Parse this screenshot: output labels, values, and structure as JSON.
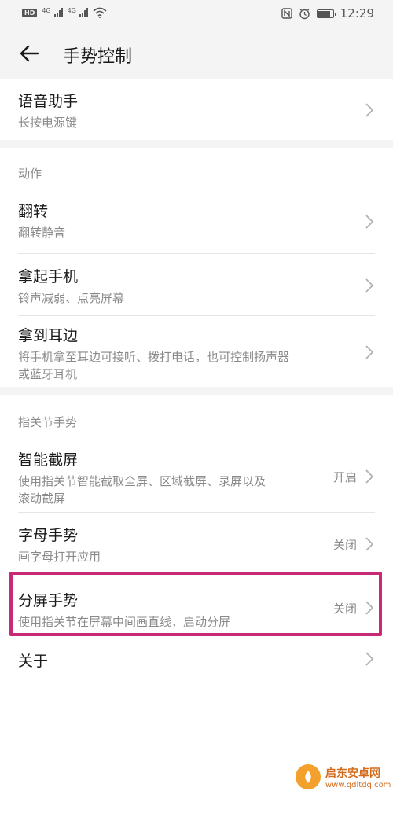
{
  "status_bar": {
    "left_badge": "HD",
    "net1": "4G",
    "net2": "4G",
    "time": "12:29",
    "nfc": "N",
    "icons": [
      "hd-badge-icon",
      "signal-icon",
      "wifi-icon",
      "nfc-icon",
      "alarm-icon",
      "battery-icon"
    ]
  },
  "header": {
    "title": "手势控制"
  },
  "voice": {
    "title": "语音助手",
    "subtitle": "长按电源键"
  },
  "section_actions": {
    "label": "动作",
    "items": [
      {
        "title": "翻转",
        "subtitle": "翻转静音"
      },
      {
        "title": "拿起手机",
        "subtitle": "铃声减弱、点亮屏幕"
      },
      {
        "title": "拿到耳边",
        "subtitle_line1": "将手机拿至耳边可接听、拨打电话，也可控制扬声器",
        "subtitle_line2": "或蓝牙耳机"
      }
    ]
  },
  "section_knuckle": {
    "label": "指关节手势",
    "items": [
      {
        "title": "智能截屏",
        "subtitle_line1": "使用指关节智能截取全屏、区域截屏、录屏以及",
        "subtitle_line2": "滚动截屏",
        "value": "开启"
      },
      {
        "title": "字母手势",
        "subtitle": "画字母打开应用",
        "value": "关闭"
      },
      {
        "title": "分屏手势",
        "subtitle": "使用指关节在屏幕中间画直线，启动分屏",
        "value": "关闭"
      }
    ]
  },
  "about": {
    "title": "关于"
  },
  "watermark": {
    "name": "启东安卓网",
    "url": "www.qdltdq.com"
  },
  "colors": {
    "highlight": "#c92a78",
    "background": "#f4f4f4",
    "secondary_text": "#8a8a8a"
  }
}
